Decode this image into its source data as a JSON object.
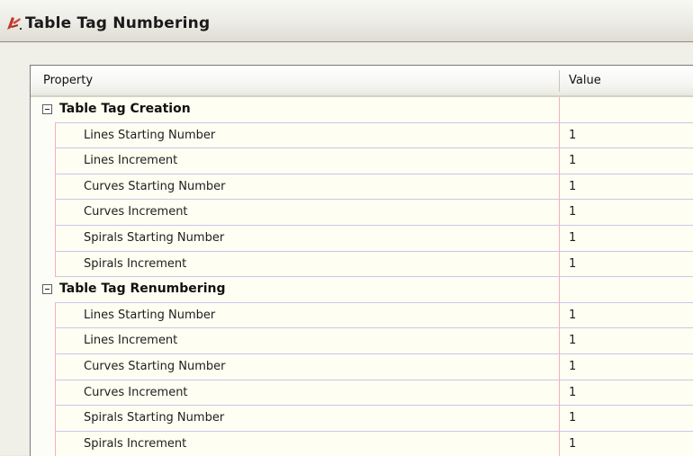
{
  "window": {
    "title": "Table Tag Numbering",
    "icon": "civil3d-app-icon"
  },
  "grid": {
    "columns": {
      "property": "Property",
      "value": "Value"
    },
    "categories": [
      {
        "label": "Table Tag Creation",
        "expanded": true,
        "rows": [
          {
            "property": "Lines Starting Number",
            "value": "1"
          },
          {
            "property": "Lines Increment",
            "value": "1"
          },
          {
            "property": "Curves Starting Number",
            "value": "1"
          },
          {
            "property": "Curves Increment",
            "value": "1"
          },
          {
            "property": "Spirals Starting Number",
            "value": "1"
          },
          {
            "property": "Spirals Increment",
            "value": "1"
          }
        ]
      },
      {
        "label": "Table Tag Renumbering",
        "expanded": true,
        "rows": [
          {
            "property": "Lines Starting Number",
            "value": "1"
          },
          {
            "property": "Lines Increment",
            "value": "1"
          },
          {
            "property": "Curves Starting Number",
            "value": "1"
          },
          {
            "property": "Curves Increment",
            "value": "1"
          },
          {
            "property": "Spirals Starting Number",
            "value": "1"
          },
          {
            "property": "Spirals Increment",
            "value": "1"
          }
        ]
      }
    ]
  }
}
